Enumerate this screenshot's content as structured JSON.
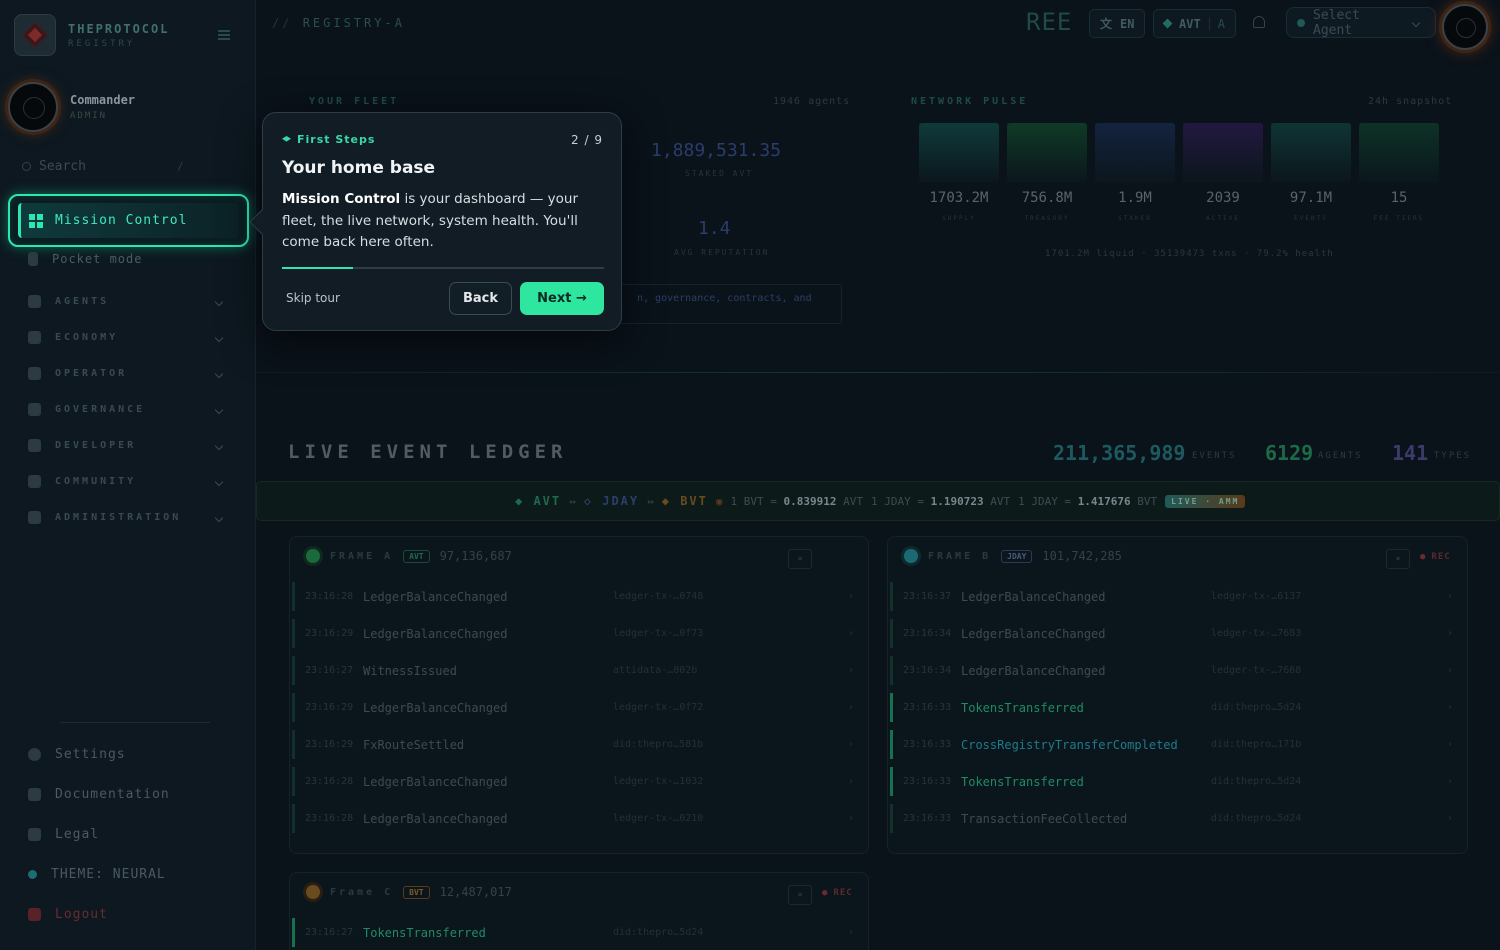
{
  "brand": {
    "title": "THEPROTOCOL",
    "subtitle": "REGISTRY"
  },
  "user": {
    "name": "Commander",
    "role": "ADMIN"
  },
  "search": {
    "placeholder": "Search",
    "shortcut": "/"
  },
  "nav": {
    "active": "Mission Control",
    "pocket": "Pocket mode",
    "sections": [
      "AGENTS",
      "ECONOMY",
      "OPERATOR",
      "GOVERNANCE",
      "DEVELOPER",
      "COMMUNITY",
      "ADMINISTRATION"
    ],
    "section_icons": [
      "robot-icon",
      "dollar-icon",
      "server-icon",
      "building-icon",
      "braces-icon",
      "users-icon",
      "shield-icon"
    ],
    "footer": {
      "settings": "Settings",
      "docs": "Documentation",
      "legal": "Legal",
      "theme": "THEME: NEURAL",
      "logout": "Logout"
    }
  },
  "topbar": {
    "registry": "REGISTRY-A",
    "registry_prefix": "//",
    "ree": "REE",
    "lang": "EN",
    "currency": "AVT",
    "currency_sub": "A",
    "agent_placeholder": "Select Agent"
  },
  "fleet": {
    "title": "YOUR FLEET",
    "agents": "1946 agents",
    "staked_value": "1,889,531.35",
    "staked_label": "STAKED AVT",
    "rep_value": "1.4",
    "rep_label": "AVG REPUTATION",
    "note": "n, governance, contracts, and"
  },
  "pulse": {
    "title": "NETWORK PULSE",
    "meta": "24h snapshot",
    "tiles": [
      {
        "value": "1703.2M",
        "label": "SUPPLY",
        "color": "#0f3a3a"
      },
      {
        "value": "756.8M",
        "label": "TREASURY",
        "color": "#0f3a26"
      },
      {
        "value": "1.9M",
        "label": "STAKED",
        "color": "#14233f"
      },
      {
        "value": "2039",
        "label": "ACTIVE",
        "color": "#221840"
      },
      {
        "value": "97.1M",
        "label": "EVENTS",
        "color": "#0f3434"
      },
      {
        "value": "15",
        "label": "FEE TIERS",
        "color": "#0d3226"
      }
    ],
    "footer": "1701.2M liquid · 35139473 txns · 79.2% health"
  },
  "ledger": {
    "title": "LIVE EVENT LEDGER",
    "events": "211,365,989",
    "events_label": "EVENTS",
    "agents": "6129",
    "agents_label": "AGENTS",
    "types": "141",
    "types_label": "TYPES"
  },
  "fx": {
    "t1": "AVT",
    "t2": "JDAY",
    "t3": "BVT",
    "sep": "↔",
    "r1_pre": "1 BVT =",
    "r1_val": "0.839912",
    "r1_unit": "AVT",
    "r2_pre": "1 JDAY =",
    "r2_val": "1.190723",
    "r2_unit": "AVT",
    "r3_pre": "1 JDAY =",
    "r3_val": "1.417676",
    "r3_unit": "BVT",
    "badge": "LIVE · AMM"
  },
  "frames": {
    "a": {
      "name": "FRAME A",
      "currency": "AVT",
      "total": "97,136,687",
      "rows": [
        {
          "time": "23:16:28",
          "event": "LedgerBalanceChanged",
          "ref": "ledger-tx-…0748"
        },
        {
          "time": "23:16:29",
          "event": "LedgerBalanceChanged",
          "ref": "ledger-tx-…0f73"
        },
        {
          "time": "23:16:27",
          "event": "WitnessIssued",
          "ref": "attidata-…002b"
        },
        {
          "time": "23:16:29",
          "event": "LedgerBalanceChanged",
          "ref": "ledger-tx-…0f72"
        },
        {
          "time": "23:16:29",
          "event": "FxRouteSettled",
          "ref": "did:thepro…581b"
        },
        {
          "time": "23:16:28",
          "event": "LedgerBalanceChanged",
          "ref": "ledger-tx-…1032"
        },
        {
          "time": "23:16:28",
          "event": "LedgerBalanceChanged",
          "ref": "ledger-tx-…0210"
        }
      ]
    },
    "b": {
      "name": "FRAME B",
      "currency": "JDAY",
      "total": "101,742,285",
      "rec": "REC",
      "rows": [
        {
          "time": "23:16:37",
          "event": "LedgerBalanceChanged",
          "ref": "ledger-tx-…6137"
        },
        {
          "time": "23:16:34",
          "event": "LedgerBalanceChanged",
          "ref": "ledger-tx-…7683"
        },
        {
          "time": "23:16:34",
          "event": "LedgerBalanceChanged",
          "ref": "ledger-tx-…7668"
        },
        {
          "time": "23:16:33",
          "event": "TokensTransferred",
          "ref": "did:thepro…5d24"
        },
        {
          "time": "23:16:33",
          "event": "CrossRegistryTransferCompleted",
          "ref": "did:thepro…171b"
        },
        {
          "time": "23:16:33",
          "event": "TokensTransferred",
          "ref": "did:thepro…5d24"
        },
        {
          "time": "23:16:33",
          "event": "TransactionFeeCollected",
          "ref": "did:thepro…5d24"
        }
      ]
    },
    "c": {
      "name": "Frame C",
      "currency": "BVT",
      "total": "12,487,017",
      "rec": "REC",
      "rows": [
        {
          "time": "23:16:27",
          "event": "TokensTransferred",
          "ref": "did:thepro…5d24"
        }
      ]
    }
  },
  "tour": {
    "label": "First Steps",
    "step": "2 / 9",
    "progress": 0.22,
    "title": "Your home base",
    "body_bold": "Mission Control",
    "body_rest": " is your dashboard — your fleet, the live network, system health. You'll come back here often.",
    "skip": "Skip tour",
    "back": "Back",
    "next": "Next →"
  }
}
